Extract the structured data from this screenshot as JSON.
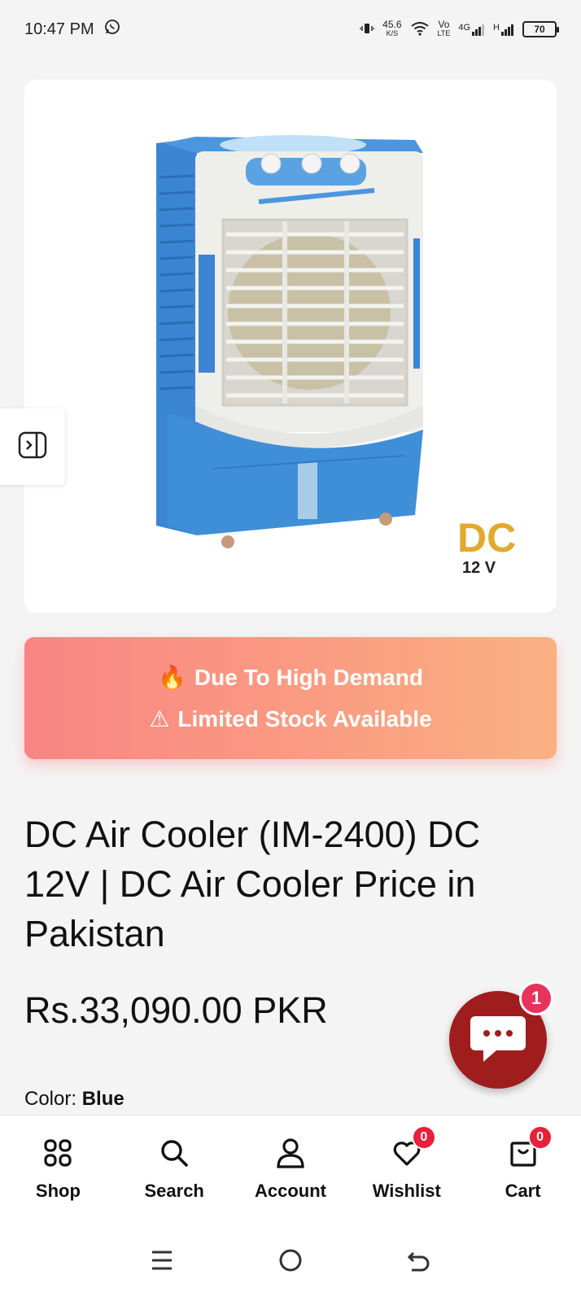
{
  "status_bar": {
    "time": "10:47 PM",
    "net_speed_value": "45.6",
    "net_speed_unit": "K/S",
    "volte_top": "Vo",
    "volte_bottom": "LTE",
    "network_4g": "4G",
    "network_h": "H",
    "battery": "70"
  },
  "product_image": {
    "brand_badge_top": "DC",
    "brand_badge_bottom": "12 V"
  },
  "demand_banner": {
    "line1_icon": "🔥",
    "line1": "Due To High Demand",
    "line2_icon": "⚠",
    "line2": "Limited Stock Available"
  },
  "product": {
    "title": "DC Air Cooler (IM-2400) DC 12V | DC Air Cooler Price in Pakistan",
    "price": "Rs.33,090.00 PKR",
    "color_label": "Color:",
    "color_value": "Blue"
  },
  "chat": {
    "badge_count": "1"
  },
  "bottom_nav": {
    "items": [
      {
        "label": "Shop",
        "icon": "grid-icon"
      },
      {
        "label": "Search",
        "icon": "search-icon"
      },
      {
        "label": "Account",
        "icon": "user-icon"
      },
      {
        "label": "Wishlist",
        "icon": "heart-icon",
        "badge": "0"
      },
      {
        "label": "Cart",
        "icon": "cart-icon",
        "badge": "0"
      }
    ]
  },
  "colors": {
    "banner_start": "#f98583",
    "banner_end": "#fbb083",
    "chat_bg": "#a01d1d",
    "badge_red": "#e8203b",
    "cooler_blue": "#3f8ed8"
  }
}
